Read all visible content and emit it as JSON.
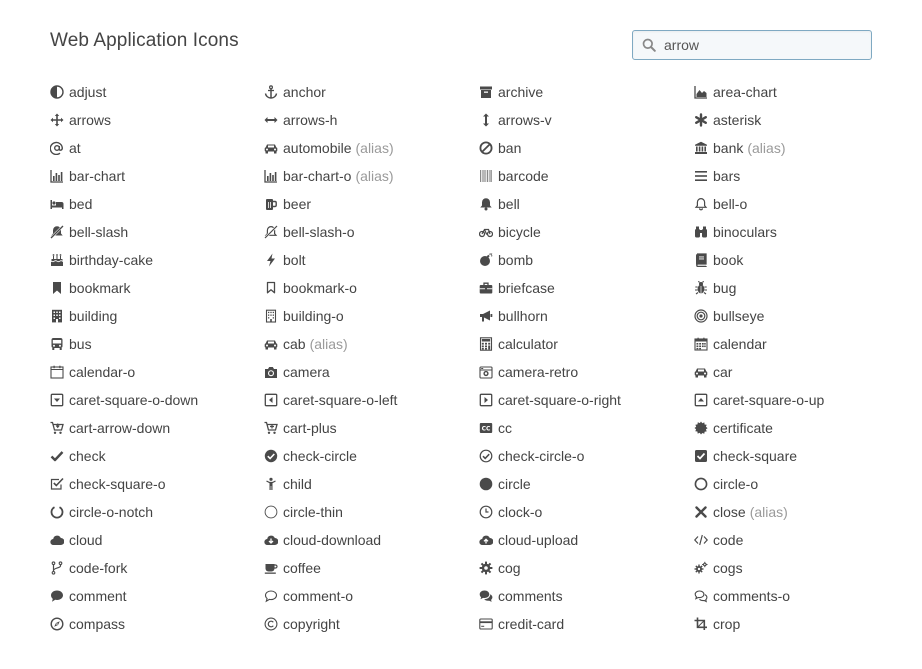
{
  "page": {
    "title": "Web Application Icons"
  },
  "search": {
    "value": "arrow",
    "icon": "search-icon"
  },
  "icons": [
    {
      "name": "adjust",
      "icon": "adjust",
      "alias": ""
    },
    {
      "name": "anchor",
      "icon": "anchor",
      "alias": ""
    },
    {
      "name": "archive",
      "icon": "archive",
      "alias": ""
    },
    {
      "name": "area-chart",
      "icon": "area-chart",
      "alias": ""
    },
    {
      "name": "arrows",
      "icon": "arrows",
      "alias": ""
    },
    {
      "name": "arrows-h",
      "icon": "arrows-h",
      "alias": ""
    },
    {
      "name": "arrows-v",
      "icon": "arrows-v",
      "alias": ""
    },
    {
      "name": "asterisk",
      "icon": "asterisk",
      "alias": ""
    },
    {
      "name": "at",
      "icon": "at",
      "alias": ""
    },
    {
      "name": "automobile",
      "icon": "car",
      "alias": "(alias)"
    },
    {
      "name": "ban",
      "icon": "ban",
      "alias": ""
    },
    {
      "name": "bank",
      "icon": "bank",
      "alias": "(alias)"
    },
    {
      "name": "bar-chart",
      "icon": "bar-chart",
      "alias": ""
    },
    {
      "name": "bar-chart-o",
      "icon": "bar-chart",
      "alias": "(alias)"
    },
    {
      "name": "barcode",
      "icon": "barcode",
      "alias": ""
    },
    {
      "name": "bars",
      "icon": "bars",
      "alias": ""
    },
    {
      "name": "bed",
      "icon": "bed",
      "alias": ""
    },
    {
      "name": "beer",
      "icon": "beer",
      "alias": ""
    },
    {
      "name": "bell",
      "icon": "bell",
      "alias": ""
    },
    {
      "name": "bell-o",
      "icon": "bell-o",
      "alias": ""
    },
    {
      "name": "bell-slash",
      "icon": "bell-slash",
      "alias": ""
    },
    {
      "name": "bell-slash-o",
      "icon": "bell-slash-o",
      "alias": ""
    },
    {
      "name": "bicycle",
      "icon": "bicycle",
      "alias": ""
    },
    {
      "name": "binoculars",
      "icon": "binoculars",
      "alias": ""
    },
    {
      "name": "birthday-cake",
      "icon": "birthday-cake",
      "alias": ""
    },
    {
      "name": "bolt",
      "icon": "bolt",
      "alias": ""
    },
    {
      "name": "bomb",
      "icon": "bomb",
      "alias": ""
    },
    {
      "name": "book",
      "icon": "book",
      "alias": ""
    },
    {
      "name": "bookmark",
      "icon": "bookmark",
      "alias": ""
    },
    {
      "name": "bookmark-o",
      "icon": "bookmark-o",
      "alias": ""
    },
    {
      "name": "briefcase",
      "icon": "briefcase",
      "alias": ""
    },
    {
      "name": "bug",
      "icon": "bug",
      "alias": ""
    },
    {
      "name": "building",
      "icon": "building",
      "alias": ""
    },
    {
      "name": "building-o",
      "icon": "building-o",
      "alias": ""
    },
    {
      "name": "bullhorn",
      "icon": "bullhorn",
      "alias": ""
    },
    {
      "name": "bullseye",
      "icon": "bullseye",
      "alias": ""
    },
    {
      "name": "bus",
      "icon": "bus",
      "alias": ""
    },
    {
      "name": "cab",
      "icon": "car",
      "alias": "(alias)"
    },
    {
      "name": "calculator",
      "icon": "calculator",
      "alias": ""
    },
    {
      "name": "calendar",
      "icon": "calendar",
      "alias": ""
    },
    {
      "name": "calendar-o",
      "icon": "calendar-o",
      "alias": ""
    },
    {
      "name": "camera",
      "icon": "camera",
      "alias": ""
    },
    {
      "name": "camera-retro",
      "icon": "camera-retro",
      "alias": ""
    },
    {
      "name": "car",
      "icon": "car",
      "alias": ""
    },
    {
      "name": "caret-square-o-down",
      "icon": "caret-square-down",
      "alias": ""
    },
    {
      "name": "caret-square-o-left",
      "icon": "caret-square-left",
      "alias": ""
    },
    {
      "name": "caret-square-o-right",
      "icon": "caret-square-right",
      "alias": ""
    },
    {
      "name": "caret-square-o-up",
      "icon": "caret-square-up",
      "alias": ""
    },
    {
      "name": "cart-arrow-down",
      "icon": "cart-arrow-down",
      "alias": ""
    },
    {
      "name": "cart-plus",
      "icon": "cart-plus",
      "alias": ""
    },
    {
      "name": "cc",
      "icon": "cc",
      "alias": ""
    },
    {
      "name": "certificate",
      "icon": "certificate",
      "alias": ""
    },
    {
      "name": "check",
      "icon": "check",
      "alias": ""
    },
    {
      "name": "check-circle",
      "icon": "check-circle",
      "alias": ""
    },
    {
      "name": "check-circle-o",
      "icon": "check-circle-o",
      "alias": ""
    },
    {
      "name": "check-square",
      "icon": "check-square",
      "alias": ""
    },
    {
      "name": "check-square-o",
      "icon": "check-square-o",
      "alias": ""
    },
    {
      "name": "child",
      "icon": "child",
      "alias": ""
    },
    {
      "name": "circle",
      "icon": "circle",
      "alias": ""
    },
    {
      "name": "circle-o",
      "icon": "circle-o",
      "alias": ""
    },
    {
      "name": "circle-o-notch",
      "icon": "circle-o-notch",
      "alias": ""
    },
    {
      "name": "circle-thin",
      "icon": "circle-thin",
      "alias": ""
    },
    {
      "name": "clock-o",
      "icon": "clock-o",
      "alias": ""
    },
    {
      "name": "close",
      "icon": "close",
      "alias": "(alias)"
    },
    {
      "name": "cloud",
      "icon": "cloud",
      "alias": ""
    },
    {
      "name": "cloud-download",
      "icon": "cloud-download",
      "alias": ""
    },
    {
      "name": "cloud-upload",
      "icon": "cloud-upload",
      "alias": ""
    },
    {
      "name": "code",
      "icon": "code",
      "alias": ""
    },
    {
      "name": "code-fork",
      "icon": "code-fork",
      "alias": ""
    },
    {
      "name": "coffee",
      "icon": "coffee",
      "alias": ""
    },
    {
      "name": "cog",
      "icon": "cog",
      "alias": ""
    },
    {
      "name": "cogs",
      "icon": "cogs",
      "alias": ""
    },
    {
      "name": "comment",
      "icon": "comment",
      "alias": ""
    },
    {
      "name": "comment-o",
      "icon": "comment-o",
      "alias": ""
    },
    {
      "name": "comments",
      "icon": "comments",
      "alias": ""
    },
    {
      "name": "comments-o",
      "icon": "comments-o",
      "alias": ""
    },
    {
      "name": "compass",
      "icon": "compass",
      "alias": ""
    },
    {
      "name": "copyright",
      "icon": "copyright",
      "alias": ""
    },
    {
      "name": "credit-card",
      "icon": "credit-card",
      "alias": ""
    },
    {
      "name": "crop",
      "icon": "crop",
      "alias": ""
    }
  ]
}
